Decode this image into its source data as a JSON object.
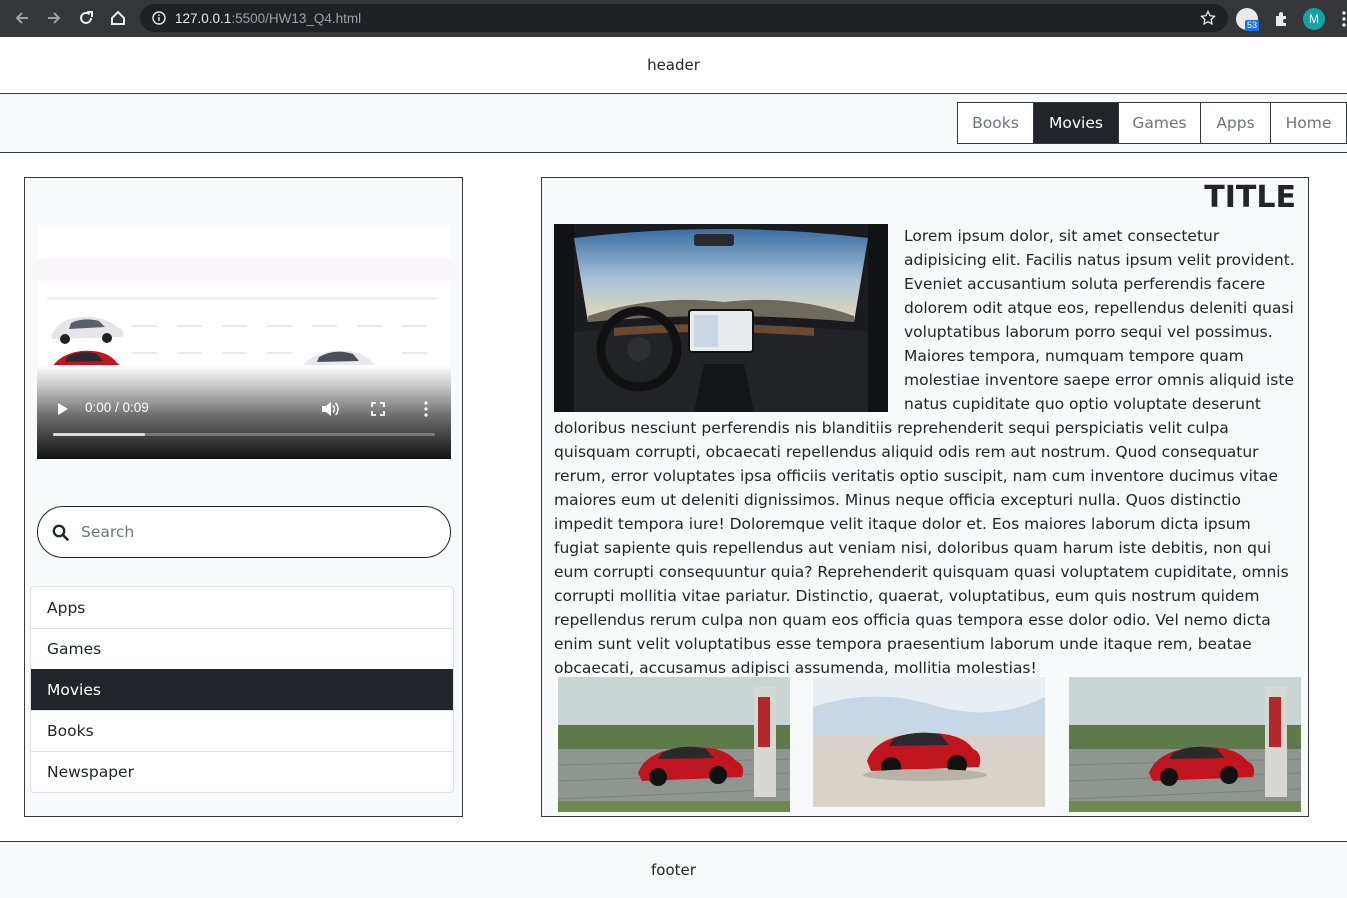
{
  "browser": {
    "url_host": "127.0.0.1",
    "url_path": ":5500/HW13_Q4.html",
    "extension_badge": "53",
    "profile_initial": "M",
    "icons": [
      "back-icon",
      "forward-icon",
      "reload-icon",
      "home-icon",
      "info-icon",
      "star-icon",
      "extensions-icon",
      "menu-icon"
    ]
  },
  "header": {
    "text": "header"
  },
  "topnav": {
    "items": [
      {
        "label": "Books"
      },
      {
        "label": "Movies",
        "active": true
      },
      {
        "label": "Games"
      },
      {
        "label": "Apps"
      },
      {
        "label": "Home"
      }
    ]
  },
  "sidebar": {
    "video": {
      "time": "0:00 / 0:09",
      "progress_fraction": 0.24
    },
    "search": {
      "placeholder": "Search"
    },
    "list": [
      {
        "label": "Apps"
      },
      {
        "label": "Games"
      },
      {
        "label": "Movies",
        "active": true
      },
      {
        "label": "Books"
      },
      {
        "label": "Newspaper"
      }
    ]
  },
  "main": {
    "title": "TITLE",
    "body": "Lorem ipsum dolor, sit amet consectetur adipisicing elit. Facilis natus ipsum velit provident. Eveniet accusantium soluta perferendis facere dolorem odit atque eos, repellendus deleniti quasi voluptatibus laborum porro sequi vel possimus. Maiores tempora, numquam tempore quam molestiae inventore saepe error omnis aliquid iste natus cupiditate quo optio voluptate deserunt doloribus nesciunt perferendis nis blanditiis reprehenderit sequi perspiciatis velit culpa quisquam corrupti, obcaecati repellendus aliquid odis rem aut nostrum. Quod consequatur rerum, error voluptates ipsa officiis veritatis optio suscipit, nam cum inventore ducimus vitae maiores eum ut deleniti dignissimos. Minus neque officia excepturi nulla. Quos distinctio impedit tempora iure! Doloremque velit itaque dolor et. Eos maiores laborum dicta ipsum fugiat sapiente quis repellendus aut veniam nisi, doloribus quam harum iste debitis, non qui eum corrupti consequuntur quia? Reprehenderit quisquam quasi voluptatem cupiditate, omnis corrupti mollitia vitae pariatur. Distinctio, quaerat, voluptatibus, eum quis nostrum quidem repellendus rerum culpa non quam eos officia quas tempora esse dolor odio. Vel nemo dicta enim sunt velit voluptatibus esse tempora praesentium laborum unde itaque rem, beatae obcaecati, accusamus adipisci assumenda, mollitia molestias!"
  },
  "footer": {
    "text": "footer"
  },
  "colors": {
    "dark": "#212529",
    "light_bg": "#f8f9fa",
    "muted": "#6c757d",
    "car_red": "#c0141f"
  }
}
